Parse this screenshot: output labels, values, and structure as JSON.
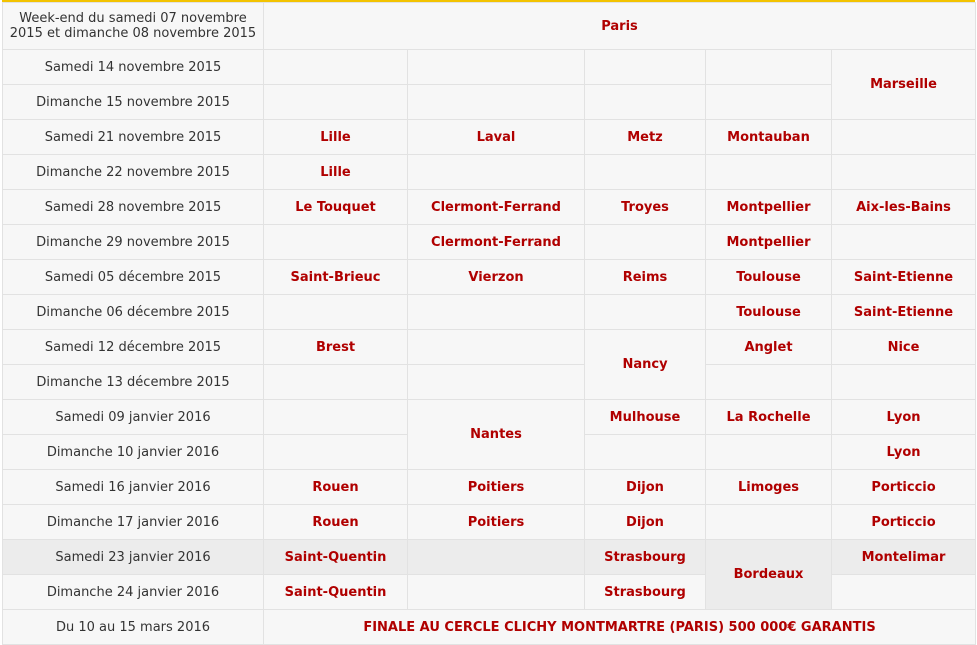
{
  "colors": {
    "accent_top": "#f3c300",
    "city_text": "#b00000",
    "date_text": "#333333"
  },
  "header": {
    "weekend_label": "Week-end du samedi 07 novembre 2015 et dimanche 08 novembre 2015",
    "city": "Paris"
  },
  "rows": [
    {
      "date": "Samedi 14 novembre 2015"
    },
    {
      "date": "Dimanche 15 novembre 2015"
    },
    {
      "date": "Samedi 21 novembre 2015"
    },
    {
      "date": "Dimanche 22 novembre 2015"
    },
    {
      "date": "Samedi 28 novembre 2015"
    },
    {
      "date": "Dimanche 29 novembre 2015"
    },
    {
      "date": "Samedi 05 décembre 2015"
    },
    {
      "date": "Dimanche 06 décembre 2015"
    },
    {
      "date": "Samedi 12 décembre 2015"
    },
    {
      "date": "Dimanche 13 décembre 2015"
    },
    {
      "date": "Samedi 09 janvier 2016"
    },
    {
      "date": "Dimanche 10 janvier 2016"
    },
    {
      "date": "Samedi 16 janvier 2016"
    },
    {
      "date": "Dimanche 17 janvier 2016"
    },
    {
      "date": "Samedi 23 janvier 2016"
    },
    {
      "date": "Dimanche 24 janvier 2016"
    }
  ],
  "cities": {
    "marseille": "Marseille",
    "lille": "Lille",
    "laval": "Laval",
    "metz": "Metz",
    "montauban": "Montauban",
    "le_touquet": "Le Touquet",
    "clermont_ferrand": "Clermont-Ferrand",
    "troyes": "Troyes",
    "montpellier": "Montpellier",
    "aix_les_bains": "Aix-les-Bains",
    "saint_brieuc": "Saint-Brieuc",
    "vierzon": "Vierzon",
    "reims": "Reims",
    "toulouse": "Toulouse",
    "saint_etienne": "Saint-Etienne",
    "brest": "Brest",
    "nancy": "Nancy",
    "anglet": "Anglet",
    "nice": "Nice",
    "nantes": "Nantes",
    "mulhouse": "Mulhouse",
    "la_rochelle": "La Rochelle",
    "lyon": "Lyon",
    "rouen": "Rouen",
    "poitiers": "Poitiers",
    "dijon": "Dijon",
    "limoges": "Limoges",
    "porticcio": "Porticcio",
    "saint_quentin": "Saint-Quentin",
    "strasbourg": "Strasbourg",
    "bordeaux": "Bordeaux",
    "montelimar": "Montelimar"
  },
  "final": {
    "date": "Du 10 au 15 mars 2016",
    "label": "FINALE AU CERCLE CLICHY MONTMARTRE (PARIS) 500 000€ GARANTIS"
  }
}
